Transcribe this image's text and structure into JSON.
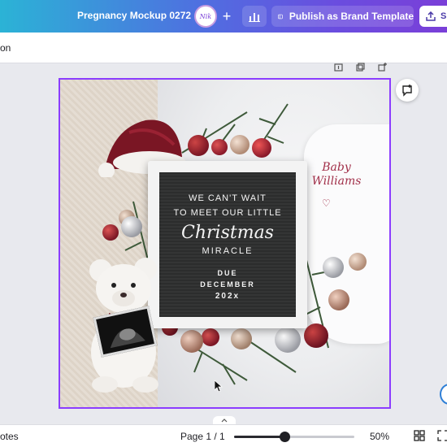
{
  "header": {
    "doc_title": "Pregnancy Mockup 0272",
    "avatar_text": "Nik",
    "publish_label": "Publish as Brand Template",
    "share_label": "S"
  },
  "toolbar": {
    "partial_label": "on"
  },
  "design": {
    "board_line1": "WE CAN'T WAIT",
    "board_line2": "TO MEET OUR LITTLE",
    "board_script": "Christmas",
    "board_line3": "MIRACLE",
    "board_due": "DUE",
    "board_month": "DECEMBER",
    "board_year": "202x",
    "baby_name_line1": "Baby",
    "baby_name_line2": "Williams",
    "heart_glyph": "♡"
  },
  "footer": {
    "notes_label": "otes",
    "page_indicator": "Page 1 / 1",
    "zoom_label": "50%",
    "zoom_fraction": 0.42
  },
  "colors": {
    "accent": "#8b3dff",
    "burgundy": "#a2304a"
  }
}
